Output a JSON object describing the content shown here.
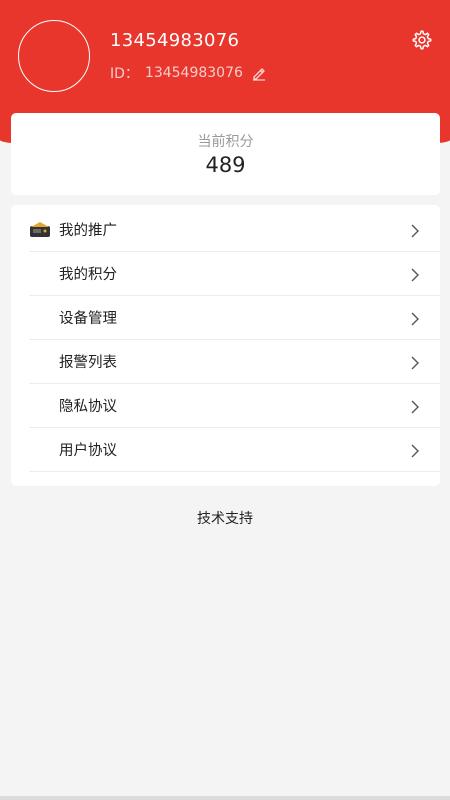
{
  "profile": {
    "phone": "13454983076",
    "id_label": "ID：",
    "id_value": "13454983076"
  },
  "points": {
    "label": "当前积分",
    "value": "489"
  },
  "menu": {
    "items": [
      {
        "label": "我的推广",
        "icon": "promotion-badge-icon"
      },
      {
        "label": "我的积分"
      },
      {
        "label": "设备管理"
      },
      {
        "label": "报警列表"
      },
      {
        "label": "隐私协议"
      },
      {
        "label": "用户协议"
      }
    ]
  },
  "footer": {
    "tech_support": "技术支持"
  },
  "colors": {
    "header": "#e8362d",
    "background": "#f4f4f4",
    "card": "#ffffff"
  }
}
